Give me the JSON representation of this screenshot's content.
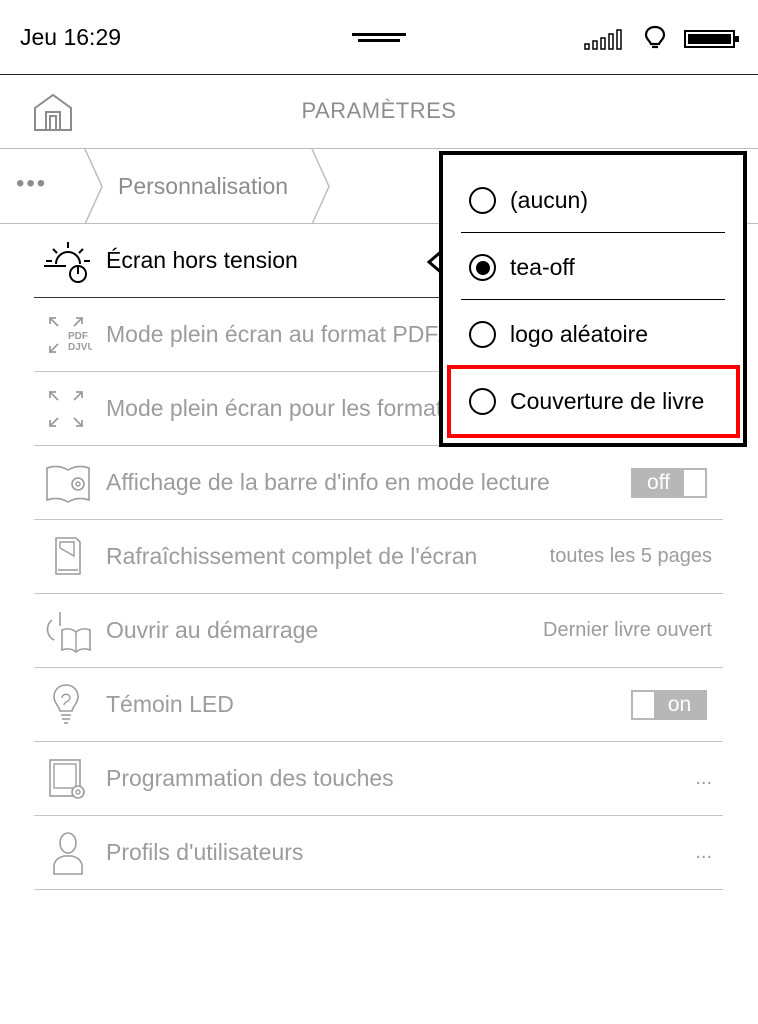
{
  "status_bar": {
    "clock": "Jeu 16:29",
    "signal_icon": "signal-bars-icon",
    "light_icon": "lightbulb-icon",
    "battery_icon": "battery-full-icon"
  },
  "header": {
    "home_icon": "home-icon",
    "title": "PARAMÈTRES"
  },
  "breadcrumb": {
    "more": "•••",
    "current": "Personnalisation"
  },
  "settings": {
    "items": [
      {
        "label": "Écran hors tension",
        "icon": "sun-power-icon",
        "active": true
      },
      {
        "label": "Mode plein écran au format PDF/DJVU",
        "icon": "fullscreen-pdf-djvu-icon",
        "icon_text_1": "PDF",
        "icon_text_2": "DJVU"
      },
      {
        "label": "Mode plein écran pour les formats",
        "icon": "fullscreen-arrows-icon"
      },
      {
        "label": "Affichage de la barre d'info en mode lecture",
        "icon": "book-gear-icon",
        "toggle": "off"
      },
      {
        "label": "Rafraîchissement complet de l'écran",
        "icon": "page-refresh-icon",
        "value": "toutes les 5 pages"
      },
      {
        "label": "Ouvrir au démarrage",
        "icon": "power-book-icon",
        "value": "Dernier livre ouvert"
      },
      {
        "label": "Témoin LED",
        "icon": "led-bulb-icon",
        "toggle": "on"
      },
      {
        "label": "Programmation des touches",
        "icon": "keys-gear-icon",
        "value": "..."
      },
      {
        "label": "Profils d'utilisateurs",
        "icon": "user-profile-icon",
        "value": "..."
      }
    ]
  },
  "popup": {
    "options": [
      {
        "label": "(aucun)",
        "selected": false
      },
      {
        "label": "tea-off",
        "selected": true
      },
      {
        "label": "logo aléatoire",
        "selected": false
      },
      {
        "label": "Couverture de livre",
        "selected": false,
        "highlighted": true
      }
    ],
    "highlight_color": "#ff0000"
  }
}
